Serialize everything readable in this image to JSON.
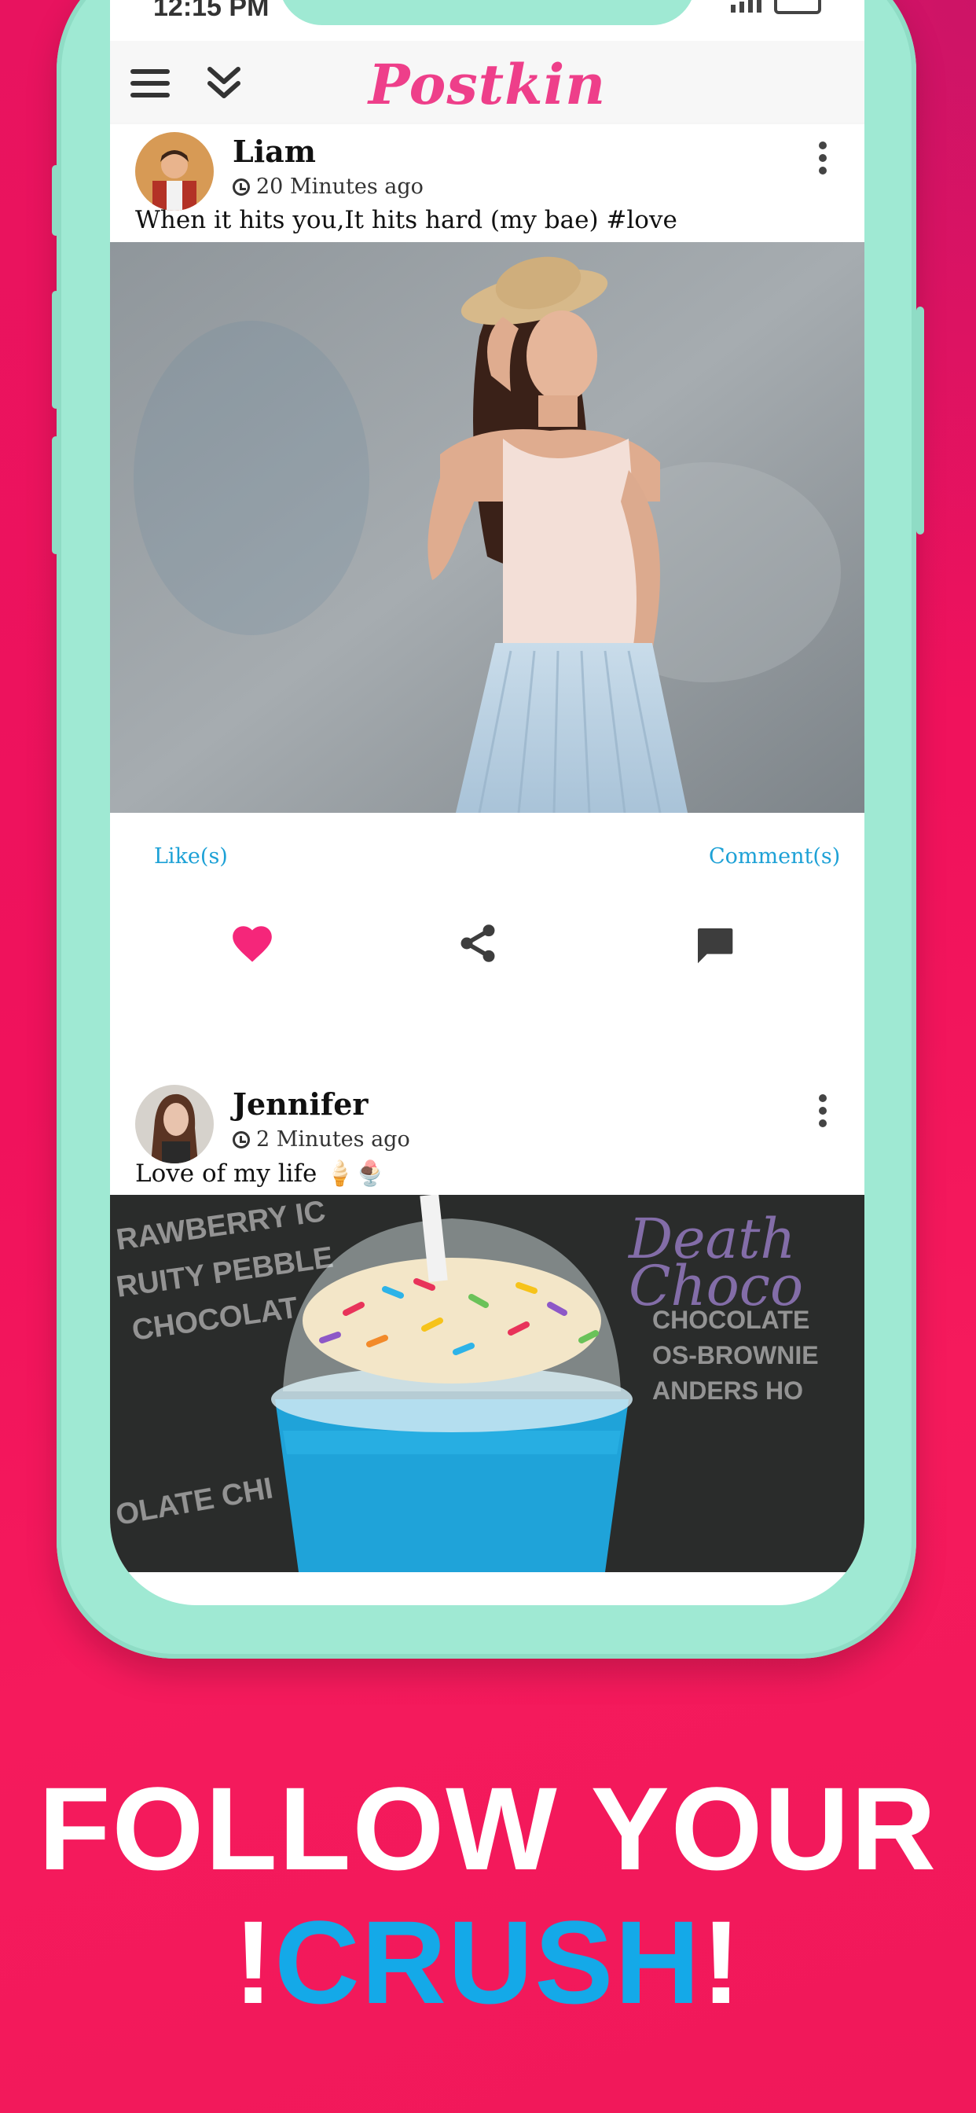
{
  "status_bar": {
    "time": "12:15 PM"
  },
  "app": {
    "title": "Postkin"
  },
  "posts": [
    {
      "author": "Liam",
      "time_ago": "20 Minutes ago",
      "caption": "When it hits you,It hits hard (my bae) #love",
      "likes_label": "Like(s)",
      "comments_label": "Comment(s)"
    },
    {
      "author": "Jennifer",
      "time_ago": "2 Minutes ago",
      "caption": "Love of my life 🍦🍨"
    }
  ],
  "promo": {
    "line1": "FOLLOW YOUR",
    "line2_prefix": "!",
    "line2_highlight": "CRUSH",
    "line2_suffix": "!"
  },
  "colors": {
    "background": "#f0125c",
    "phone_frame": "#9fe9d3",
    "brand": "#ee3f8a",
    "link": "#1da1d6",
    "like_heart": "#f5267a",
    "highlight": "#14a9e8"
  },
  "icons": [
    "menu-icon",
    "double-chevron-down-icon",
    "clock-icon",
    "more-vert-icon",
    "heart-icon",
    "share-icon",
    "comment-icon"
  ]
}
